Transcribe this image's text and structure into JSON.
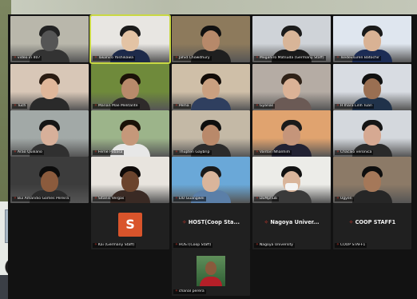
{
  "participants": [
    {
      "name": "video in 407",
      "bg": "#b9b7ab",
      "skin": "#555",
      "shirt": "#333",
      "hair": "#222"
    },
    {
      "name": "Takahiro Yoshikawa",
      "bg": "#e8e6e2",
      "skin": "#e3c3a4",
      "shirt": "#1d2a4a",
      "hair": "#1a1a1a"
    },
    {
      "name": "Jahid Chowdhury",
      "bg": "#8d7a5c",
      "skin": "#b7896a",
      "shirt": "#1f1f1f",
      "hair": "#111"
    },
    {
      "name": "Megahiro Matsuda (Germany Staff)",
      "bg": "#cfd3d8",
      "skin": "#d8b598",
      "shirt": "#1a1a1a",
      "hair": "#1b1b1b"
    },
    {
      "name": "Tsedevsuren Batochir",
      "bg": "#dfe6ef",
      "skin": "#d9b294",
      "shirt": "#1c2c55",
      "hair": "#1a1a1a"
    },
    {
      "name": "Tuch",
      "bg": "#d8c7b7",
      "skin": "#e0b79a",
      "shirt": "#2a2a2a",
      "hair": "#2a1c12"
    },
    {
      "name": "Marian Mae Melitante",
      "bg": "#6f8a3b",
      "skin": "#b88a6b",
      "shirt": "#2e2a2a",
      "hair": "#1b1208"
    },
    {
      "name": "Pema",
      "bg": "#cfbfa8",
      "skin": "#caa080",
      "shirt": "#2f3f5f",
      "hair": "#120c08"
    },
    {
      "name": "Gyanas",
      "bg": "#b5aca4",
      "skin": "#dbb296",
      "shirt": "#6b5a55",
      "hair": "#2f2218"
    },
    {
      "name": "H Ihara Linh Tuan",
      "bg": "#d8dce2",
      "skin": "#9a6f52",
      "shirt": "#20324a",
      "hair": "#101010"
    },
    {
      "name": "Arao Quiliano",
      "bg": "#a2a9a7",
      "skin": "#d7b09a",
      "shirt": "#303030",
      "hair": "#151515"
    },
    {
      "name": "Ferne Pabasa",
      "bg": "#9cb48a",
      "skin": "#c5987a",
      "shirt": "#e7e7e7",
      "hair": "#1a1208"
    },
    {
      "name": "Thupten Gaybrip",
      "bg": "#c4b9a6",
      "skin": "#b9896a",
      "shirt": "#2b2b2b",
      "hair": "#0e0e0e"
    },
    {
      "name": "Vanton Nhanhim",
      "bg": "#e0a36f",
      "skin": "#c5957a",
      "shirt": "#223",
      "hair": "#1a1a1a"
    },
    {
      "name": "Chacaio veronica",
      "bg": "#d4d8dd",
      "skin": "#d6a992",
      "shirt": "#2a2a2a",
      "hair": "#151515"
    },
    {
      "name": "Bui Amandio Gomes Pereira",
      "bg": "#3c3c3c",
      "skin": "#8b5b3d",
      "shirt": "#2b2b2b",
      "hair": "#0c0c0c"
    },
    {
      "name": "Sitanis Vergas",
      "bg": "#e8e4de",
      "skin": "#6b442d",
      "shirt": "#3a2a24",
      "hair": "#0e0a08"
    },
    {
      "name": "LIU Guangwei",
      "bg": "#6aa8d8",
      "skin": "#d9b59b",
      "shirt": "#5b7fa8",
      "hair": "#1a1a1a"
    },
    {
      "name": "DEMphub",
      "bg": "#ecece8",
      "skin": "#d9b59b",
      "shirt": "#3a3a3a",
      "hair": "#111"
    },
    {
      "name": "Ugyen",
      "bg": "#8c7a67",
      "skin": "#a57859",
      "shirt": "#262626",
      "hair": "#0e0e0e"
    }
  ],
  "avatar_tiles": [
    {
      "label": "S",
      "name": "Kai (Germany Staff)"
    },
    {
      "label": "HOST(Coop Sta...",
      "name": "HOST(Coop Staff)"
    },
    {
      "label": "Nagoya Univer...",
      "name": "Nagoya University"
    },
    {
      "label": "COOP STAFF1",
      "name": "COOP STAFF1"
    }
  ],
  "last_tile": {
    "name": "chanal perera"
  },
  "colors": {
    "mic_muted": "#e0392b",
    "active_speaker": "#c9d843",
    "avatar_orange": "#d9542b"
  }
}
